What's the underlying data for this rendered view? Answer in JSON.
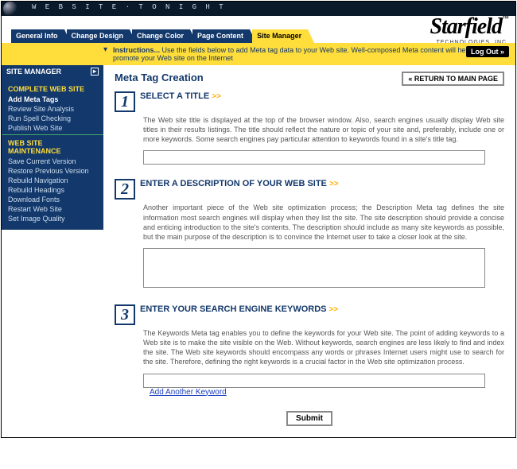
{
  "header": {
    "site_name": "W E B S I T E · T O N I G H T",
    "tabs": [
      "General Info",
      "Change Design",
      "Change Color",
      "Page Content",
      "Site Manager"
    ],
    "active_tab": 4,
    "brand_name": "Starfield",
    "brand_tm": "™",
    "brand_sub": "TECHNOLOGIES, INC.",
    "instr_label": "Instructions...",
    "instr_text": "Use the fields below to add Meta tag data to your Web site. Well-composed Meta content will help you promote your Web site on the Internet",
    "logout_label": "Log Out »"
  },
  "sidebar": {
    "title": "SITE MANAGER",
    "sections": [
      {
        "heading": "COMPLETE WEB SITE",
        "items": [
          "Add Meta Tags",
          "Review Site Analysis",
          "Run Spell Checking",
          "Publish Web Site"
        ],
        "active": 0
      },
      {
        "heading": "WEB SITE MAINTENANCE",
        "items": [
          "Save Current Version",
          "Restore Previous Version",
          "Rebuild Navigation",
          "Rebuild Headings",
          "Download Fonts",
          "Restart Web Site",
          "Set Image Quality"
        ],
        "active": -1
      }
    ]
  },
  "main": {
    "title": "Meta Tag Creation",
    "return_label": "« RETURN TO MAIN PAGE",
    "steps": [
      {
        "num": "1",
        "title": "SELECT A TITLE",
        "arrow": ">>",
        "text": "The Web site title is displayed at the top of the browser window. Also, search engines usually display Web site titles in their results listings. The title should reflect the nature or topic of your site and, preferably, include one or more keywords. Some search engines pay particular attention to keywords found in a site's title tag.",
        "kind": "input",
        "value": ""
      },
      {
        "num": "2",
        "title": "ENTER A DESCRIPTION OF YOUR WEB SITE",
        "arrow": ">>",
        "text": "Another important piece of the Web site optimization process; the Description Meta tag defines the site information most search engines will display when they list the site. The site description should provide a concise and enticing introduction to the site's contents. The description should include as many site keywords as possible, but the main purpose of the description is to convince the Internet user to take a closer look at the site.",
        "kind": "textarea",
        "value": ""
      },
      {
        "num": "3",
        "title": "ENTER YOUR SEARCH ENGINE KEYWORDS",
        "arrow": ">>",
        "text": "The Keywords Meta tag enables you to define the keywords for your Web site. The point of adding keywords to a Web site is to make the site visible on the Web. Without keywords, search engines are less likely to find and index the site. The Web site keywords should encompass any words or phrases Internet users might use to search for the site. Therefore, defining the right keywords is a crucial factor in the Web site optimization process.",
        "kind": "input",
        "value": "",
        "add_link": "Add Another Keyword"
      }
    ],
    "submit_label": "Submit"
  }
}
